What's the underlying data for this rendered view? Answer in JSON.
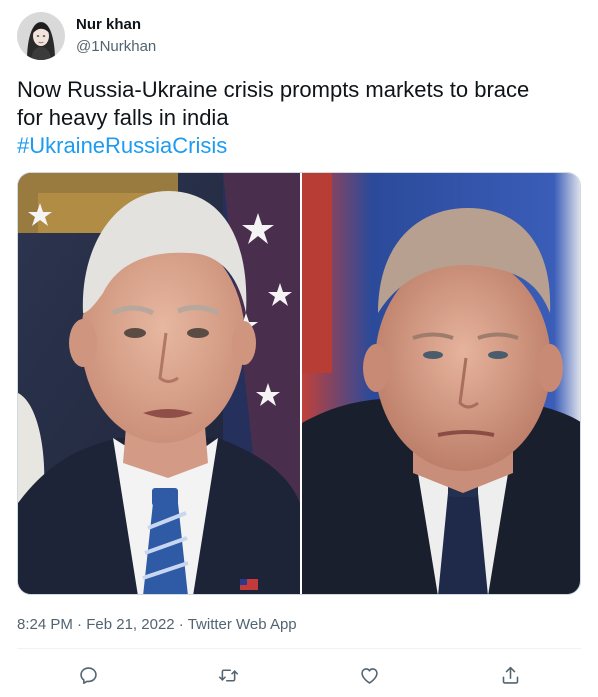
{
  "author": {
    "name": "Nur khan",
    "handle": "@1Nurkhan",
    "avatar_icon": "profile-avatar"
  },
  "tweet": {
    "text_line1": "Now Russia-Ukraine crisis prompts markets to brace",
    "text_line2": "for heavy falls in india",
    "hashtag": "#UkraineRussiaCrisis",
    "time": "8:24 PM",
    "sep1": " · ",
    "date": "Feb 21, 2022",
    "sep2": " · ",
    "source": "Twitter Web App"
  },
  "media": {
    "left_panel": "photo-man-white-hair-flag-background",
    "right_panel": "photo-man-dark-suit-flag-background"
  },
  "actions": [
    {
      "name": "reply",
      "icon": "reply-icon"
    },
    {
      "name": "retweet",
      "icon": "retweet-icon"
    },
    {
      "name": "like",
      "icon": "heart-icon"
    },
    {
      "name": "share",
      "icon": "share-icon"
    }
  ],
  "colors": {
    "link": "#1d9bf0",
    "secondary_text": "#536471",
    "primary_text": "#0f1419",
    "divider": "#eff3f4"
  }
}
